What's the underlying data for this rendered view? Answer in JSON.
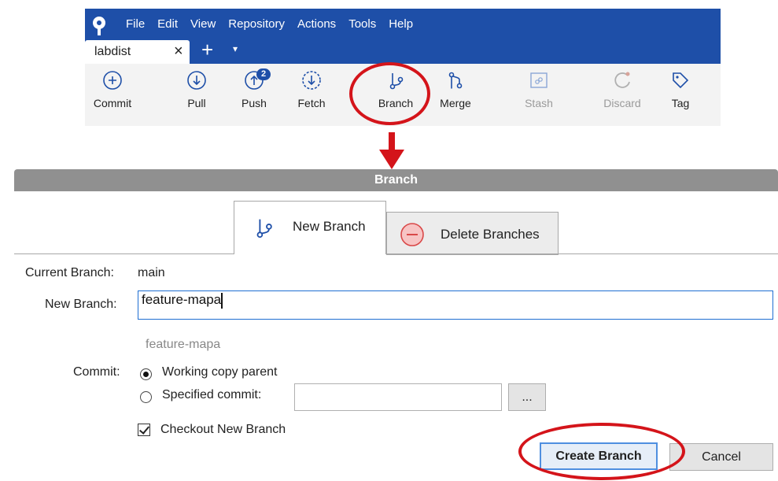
{
  "menu": [
    "File",
    "Edit",
    "View",
    "Repository",
    "Actions",
    "Tools",
    "Help"
  ],
  "repo_tab": {
    "label": "labdist",
    "close": "×",
    "add": "+",
    "menu": "▾"
  },
  "toolbar": {
    "commit": "Commit",
    "pull": "Pull",
    "push": "Push",
    "push_badge": "2",
    "fetch": "Fetch",
    "branch": "Branch",
    "merge": "Merge",
    "stash": "Stash",
    "discard": "Discard",
    "tag": "Tag"
  },
  "dialog": {
    "title": "Branch",
    "tabs": {
      "new_branch": "New Branch",
      "delete_branches": "Delete Branches"
    },
    "current_branch_label": "Current Branch:",
    "current_branch_value": "main",
    "new_branch_label": "New Branch:",
    "new_branch_value": "feature-mapa",
    "preview": "feature-mapa",
    "commit_label": "Commit:",
    "option_working_copy": "Working copy parent",
    "option_specified": "Specified commit:",
    "specified_commit_value": "",
    "browse": "...",
    "checkout_label": "Checkout New Branch",
    "create_button": "Create Branch",
    "cancel_button": "Cancel"
  },
  "colors": {
    "accent": "#1e4fa8",
    "highlight": "#d4141a",
    "title_bar": "#909090"
  },
  "icons": [
    "sourcetree-logo-icon",
    "commit-plus-icon",
    "pull-arrow-icon",
    "push-arrow-icon",
    "fetch-arrow-icon",
    "branch-icon",
    "merge-icon",
    "stash-icon",
    "discard-icon",
    "tag-icon",
    "delete-minus-icon"
  ]
}
